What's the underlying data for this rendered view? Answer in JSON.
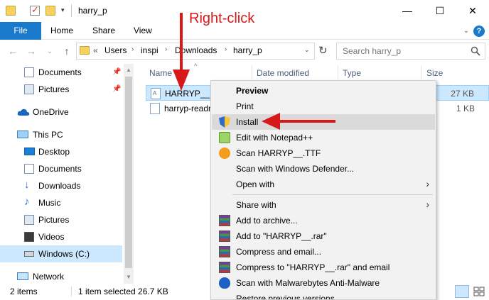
{
  "window": {
    "title": "harry_p",
    "minimize": "—",
    "maximize": "☐",
    "close": "✕"
  },
  "ribbon": {
    "file": "File",
    "tabs": [
      "Home",
      "Share",
      "View"
    ]
  },
  "address": {
    "prefix": "«",
    "crumbs": [
      "Users",
      "inspi",
      "Downloads",
      "harry_p"
    ],
    "search_placeholder": "Search harry_p"
  },
  "nav": {
    "items": [
      {
        "label": "Documents",
        "icon": "documents-icon",
        "pinned": true
      },
      {
        "label": "Pictures",
        "icon": "pictures-icon",
        "pinned": true
      },
      {
        "label": "OneDrive",
        "icon": "onedrive-icon"
      },
      {
        "label": "This PC",
        "icon": "this-pc-icon"
      },
      {
        "label": "Desktop",
        "icon": "desktop-icon"
      },
      {
        "label": "Documents",
        "icon": "documents-icon"
      },
      {
        "label": "Downloads",
        "icon": "downloads-icon"
      },
      {
        "label": "Music",
        "icon": "music-icon"
      },
      {
        "label": "Pictures",
        "icon": "pictures-icon"
      },
      {
        "label": "Videos",
        "icon": "videos-icon"
      },
      {
        "label": "Windows (C:)",
        "icon": "drive-icon",
        "selected": true
      },
      {
        "label": "Network",
        "icon": "network-icon"
      }
    ]
  },
  "columns": {
    "name": "Name",
    "date": "Date modified",
    "type": "Type",
    "size": "Size"
  },
  "files": [
    {
      "name": "HARRYP__",
      "size": "27 KB",
      "selected": true
    },
    {
      "name": "harryp-readm",
      "size": "1 KB",
      "selected": false
    }
  ],
  "status": {
    "count": "2 items",
    "selection": "1 item selected  26.7 KB"
  },
  "context_menu": {
    "items": [
      {
        "label": "Preview",
        "bold": true
      },
      {
        "label": "Print"
      },
      {
        "label": "Install",
        "icon": "uac-shield-icon",
        "hover": true
      },
      {
        "label": "Edit with Notepad++",
        "icon": "notepad-plus-icon"
      },
      {
        "label": "Scan HARRYP__.TTF",
        "icon": "avast-icon"
      },
      {
        "label": "Scan with Windows Defender..."
      },
      {
        "label": "Open with",
        "submenu": true
      },
      {
        "label": "Share with",
        "submenu": true
      },
      {
        "label": "Add to archive...",
        "icon": "winrar-icon"
      },
      {
        "label": "Add to \"HARRYP__.rar\"",
        "icon": "winrar-icon"
      },
      {
        "label": "Compress and email...",
        "icon": "winrar-icon"
      },
      {
        "label": "Compress to \"HARRYP__.rar\" and email",
        "icon": "winrar-icon"
      },
      {
        "label": "Scan with Malwarebytes Anti-Malware",
        "icon": "malwarebytes-icon"
      },
      {
        "label": "Restore previous versions"
      }
    ]
  },
  "annotation": {
    "right_click": "Right-click",
    "color": "#d61a1a"
  },
  "colors": {
    "accent": "#1979ca",
    "selection": "#cce8ff"
  }
}
